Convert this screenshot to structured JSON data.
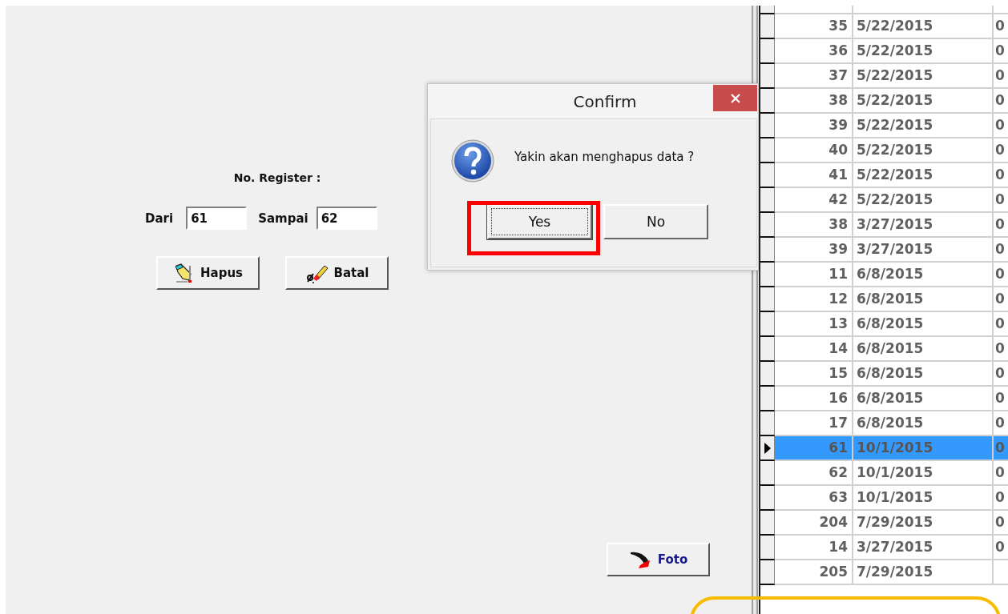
{
  "form": {
    "heading": "No. Register :",
    "from_label": "Dari",
    "from_value": "61",
    "to_label": "Sampai",
    "to_value": "62",
    "buttons": [
      {
        "kind": "delete",
        "label": "Hapus"
      },
      {
        "kind": "cancel",
        "label": "Batal"
      }
    ],
    "photo_button": "Foto"
  },
  "dialog": {
    "title": "Confirm",
    "message": "Yakin akan menghapus data ?",
    "buttons": [
      {
        "label": "Yes",
        "selected": true
      },
      {
        "label": "No",
        "selected": false
      }
    ]
  },
  "table": {
    "rows": [
      {
        "column_1": "35",
        "column_2": "5/22/2015",
        "column_3": "0",
        "selected": false
      },
      {
        "column_1": "36",
        "column_2": "5/22/2015",
        "column_3": "0",
        "selected": false
      },
      {
        "column_1": "37",
        "column_2": "5/22/2015",
        "column_3": "0",
        "selected": false
      },
      {
        "column_1": "38",
        "column_2": "5/22/2015",
        "column_3": "0",
        "selected": false
      },
      {
        "column_1": "39",
        "column_2": "5/22/2015",
        "column_3": "0",
        "selected": false
      },
      {
        "column_1": "40",
        "column_2": "5/22/2015",
        "column_3": "0",
        "selected": false
      },
      {
        "column_1": "41",
        "column_2": "5/22/2015",
        "column_3": "0",
        "selected": false
      },
      {
        "column_1": "42",
        "column_2": "5/22/2015",
        "column_3": "0",
        "selected": false
      },
      {
        "column_1": "38",
        "column_2": "3/27/2015",
        "column_3": "0",
        "selected": false
      },
      {
        "column_1": "39",
        "column_2": "3/27/2015",
        "column_3": "0",
        "selected": false
      },
      {
        "column_1": "11",
        "column_2": "6/8/2015",
        "column_3": "0",
        "selected": false
      },
      {
        "column_1": "12",
        "column_2": "6/8/2015",
        "column_3": "0",
        "selected": false
      },
      {
        "column_1": "13",
        "column_2": "6/8/2015",
        "column_3": "0",
        "selected": false
      },
      {
        "column_1": "14",
        "column_2": "6/8/2015",
        "column_3": "0",
        "selected": false
      },
      {
        "column_1": "15",
        "column_2": "6/8/2015",
        "column_3": "0",
        "selected": false
      },
      {
        "column_1": "16",
        "column_2": "6/8/2015",
        "column_3": "0",
        "selected": false
      },
      {
        "column_1": "17",
        "column_2": "6/8/2015",
        "column_3": "0",
        "selected": false
      },
      {
        "column_1": "61",
        "column_2": "10/1/2015",
        "column_3": "0",
        "selected": true
      },
      {
        "column_1": "62",
        "column_2": "10/1/2015",
        "column_3": "0",
        "selected": false
      },
      {
        "column_1": "63",
        "column_2": "10/1/2015",
        "column_3": "0",
        "selected": false
      },
      {
        "column_1": "204",
        "column_2": "7/29/2015",
        "column_3": "0",
        "selected": false
      },
      {
        "column_1": "14",
        "column_2": "3/27/2015",
        "column_3": "0",
        "selected": false
      },
      {
        "column_1": "205",
        "column_2": "7/29/2015",
        "selected": false
      }
    ]
  }
}
